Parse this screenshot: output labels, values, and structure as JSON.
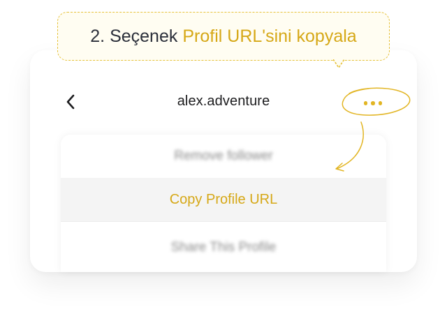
{
  "callout": {
    "step_text": "2. Seçenek",
    "highlight_text": "Profil URL'sini kopyala"
  },
  "header": {
    "back_icon": "chevron-left-icon",
    "username": "alex.adventure",
    "more_icon": "more-horizontal-icon"
  },
  "action_sheet": {
    "items": [
      {
        "label": "Remove follower",
        "state": "blurred"
      },
      {
        "label": "Copy Profile URL",
        "state": "highlighted"
      },
      {
        "label": "Share This Profile",
        "state": "blurred"
      }
    ]
  },
  "colors": {
    "accent": "#d6a817",
    "text_dark": "#2b2f3a",
    "callout_bg": "#fffdf2"
  }
}
